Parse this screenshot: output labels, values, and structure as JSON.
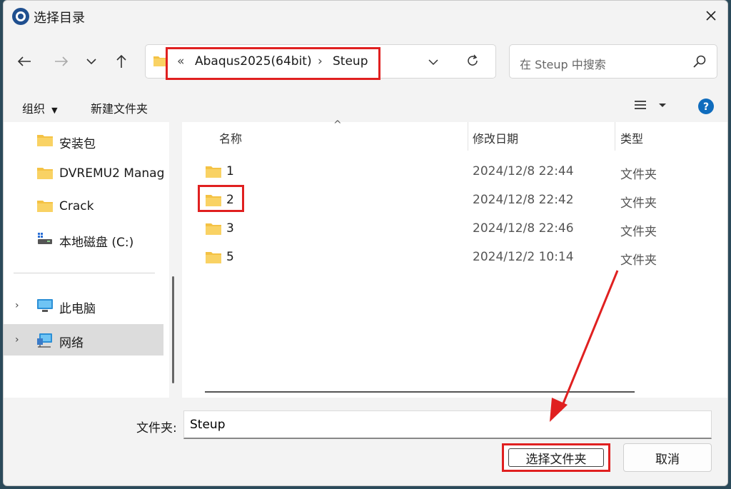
{
  "window": {
    "title": "选择目录"
  },
  "address": {
    "overflow": "«",
    "crumbs": [
      "Abaqus2025(64bit)",
      "Steup"
    ]
  },
  "search": {
    "placeholder": "在 Steup 中搜索"
  },
  "toolbar": {
    "organize": "组织",
    "new_folder": "新建文件夹"
  },
  "nav": {
    "items": [
      {
        "label": "安装包",
        "icon": "folder-icon"
      },
      {
        "label": "DVREMU2 Manag",
        "icon": "folder-icon"
      },
      {
        "label": "Crack",
        "icon": "folder-icon"
      },
      {
        "label": "本地磁盘 (C:)",
        "icon": "drive-icon"
      },
      {
        "label": "此电脑",
        "icon": "computer-icon"
      },
      {
        "label": "网络",
        "icon": "network-icon"
      }
    ]
  },
  "columns": {
    "name": "名称",
    "date": "修改日期",
    "type": "类型"
  },
  "files": [
    {
      "name": "1",
      "date": "2024/12/8 22:44",
      "type": "文件夹"
    },
    {
      "name": "2",
      "date": "2024/12/8 22:42",
      "type": "文件夹"
    },
    {
      "name": "3",
      "date": "2024/12/8 22:46",
      "type": "文件夹"
    },
    {
      "name": "5",
      "date": "2024/12/2 10:14",
      "type": "文件夹"
    }
  ],
  "footer": {
    "folder_label": "文件夹:",
    "folder_value": "Steup",
    "select_button": "选择文件夹",
    "cancel_button": "取消"
  },
  "colors": {
    "annotation": "#e02020",
    "folder": "#f4c244",
    "accent": "#0f6cbd"
  }
}
